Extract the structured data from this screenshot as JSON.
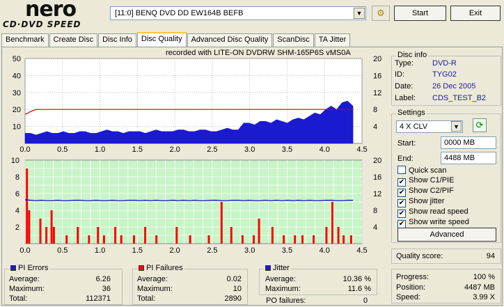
{
  "logo": {
    "brand": "nero",
    "product": "CD·DVD SPEED"
  },
  "drive": {
    "selected": "[11:0]  BENQ DVD DD EW164B BEFB"
  },
  "toolbar": {
    "start_label": "Start",
    "exit_label": "Exit"
  },
  "tabs": [
    {
      "label": "Benchmark"
    },
    {
      "label": "Create Disc"
    },
    {
      "label": "Disc Info"
    },
    {
      "label": "Disc Quality",
      "active": true
    },
    {
      "label": "Advanced Disc Quality"
    },
    {
      "label": "ScanDisc"
    },
    {
      "label": "TA Jitter"
    }
  ],
  "recorded_with": "recorded with LITE-ON DVDRW SHM-165P6S vMS0A",
  "disc_info": {
    "title": "Disc info",
    "type_label": "Type:",
    "type": "DVD-R",
    "id_label": "ID:",
    "id": "TYG02",
    "date_label": "Date:",
    "date": "26 Dec 2005",
    "label_label": "Label:",
    "label": "CDS_TEST_B2"
  },
  "settings": {
    "title": "Settings",
    "speed": "4 X CLV",
    "start_label": "Start:",
    "start": "0000 MB",
    "end_label": "End:",
    "end": "4488 MB",
    "quick_scan": "Quick scan",
    "show_c1": "Show C1/PIE",
    "show_c2": "Show C2/PIF",
    "show_jitter": "Show jitter",
    "show_read": "Show read speed",
    "show_write": "Show write speed",
    "advanced": "Advanced"
  },
  "checkboxes": {
    "quick_scan": false,
    "c1": true,
    "c2": true,
    "jitter": true,
    "read": true,
    "write": true
  },
  "quality": {
    "label": "Quality score:",
    "value": "94"
  },
  "status": {
    "progress_label": "Progress:",
    "progress": "100 %",
    "position_label": "Position:",
    "position": "4487 MB",
    "speed_label": "Speed:",
    "speed": "3.99 X"
  },
  "pi_errors": {
    "title": "PI Errors",
    "avg_label": "Average:",
    "avg": "6.26",
    "max_label": "Maximum:",
    "max": "36",
    "total_label": "Total:",
    "total": "112371"
  },
  "pi_failures": {
    "title": "PI Failures",
    "avg_label": "Average:",
    "avg": "0.02",
    "max_label": "Maximum:",
    "max": "10",
    "total_label": "Total:",
    "total": "2890"
  },
  "jitter": {
    "title": "Jitter",
    "avg_label": "Average:",
    "avg": "10.36 %",
    "max_label": "Maximum:",
    "max": "11.6 %",
    "po_label": "PO failures:",
    "po": "0"
  },
  "colors": {
    "pie": "#1a1ad0",
    "pif": "#ff0000",
    "jitter": "#0000c0",
    "speed": "#d00000",
    "green_bg": "#c8f4c8"
  },
  "chart_data": [
    {
      "type": "area",
      "x_ticks": [
        "0.0",
        "0.5",
        "1.0",
        "1.5",
        "2.0",
        "2.5",
        "3.0",
        "3.5",
        "4.0",
        "4.5"
      ],
      "y_ticks_left": [
        "10",
        "20",
        "30",
        "40",
        "50"
      ],
      "y_ticks_right": [
        "4",
        "8",
        "12",
        "16",
        "20"
      ],
      "xlim": [
        0,
        4.5
      ],
      "ylim": [
        0,
        50
      ],
      "y2lim": [
        0,
        20
      ],
      "series": [
        {
          "values": [
            6,
            6,
            5,
            6,
            7,
            6,
            6,
            7,
            6,
            6,
            7,
            7,
            6,
            6,
            7,
            8,
            7,
            7,
            6,
            7,
            7,
            7,
            6,
            7,
            8,
            7,
            7,
            7,
            8,
            8,
            7,
            7,
            8,
            8,
            7,
            7,
            8,
            9,
            8,
            8,
            12,
            12,
            11,
            13,
            13,
            12,
            14,
            13,
            12,
            14,
            15,
            14,
            16,
            18,
            17,
            20,
            22,
            20,
            24,
            25,
            22
          ]
        },
        {
          "values": [
            6.8,
            7.5,
            8,
            8,
            8,
            8,
            8,
            8,
            8,
            8,
            8,
            8,
            8,
            8,
            8,
            8,
            8,
            8,
            8,
            8,
            8,
            8,
            8,
            8,
            8,
            8,
            8,
            8,
            8,
            8,
            8,
            8,
            8,
            8,
            8,
            8,
            8,
            8,
            8,
            8,
            8,
            8,
            8,
            8,
            8,
            8,
            8,
            8,
            8,
            8,
            8,
            8,
            8,
            8,
            8,
            8,
            8,
            8,
            8,
            8,
            8
          ]
        }
      ]
    },
    {
      "type": "bar",
      "x_ticks": [
        "0.0",
        "0.5",
        "1.0",
        "1.5",
        "2.0",
        "2.5",
        "3.0",
        "3.5",
        "4.0",
        "4.5"
      ],
      "y_ticks_left": [
        "2",
        "4",
        "6",
        "8",
        "10"
      ],
      "y_ticks_right": [
        "4",
        "8",
        "12",
        "16",
        "20"
      ],
      "xlim": [
        0,
        4.5
      ],
      "ylim": [
        0,
        10
      ],
      "y2lim": [
        0,
        20
      ],
      "series": [
        {
          "points": [
            [
              0.02,
              9
            ],
            [
              0.05,
              4
            ],
            [
              0.2,
              3
            ],
            [
              0.28,
              2
            ],
            [
              0.35,
              4
            ],
            [
              0.38,
              2
            ],
            [
              0.55,
              1
            ],
            [
              0.7,
              2
            ],
            [
              0.85,
              1
            ],
            [
              0.97,
              2
            ],
            [
              1.05,
              1
            ],
            [
              1.2,
              2
            ],
            [
              1.28,
              1
            ],
            [
              1.45,
              1
            ],
            [
              1.6,
              2
            ],
            [
              1.75,
              1
            ],
            [
              2.02,
              2
            ],
            [
              2.2,
              1
            ],
            [
              2.45,
              1
            ],
            [
              2.62,
              5
            ],
            [
              2.75,
              2
            ],
            [
              2.9,
              1
            ],
            [
              3.05,
              1
            ],
            [
              3.12,
              3
            ],
            [
              3.3,
              2
            ],
            [
              3.45,
              1
            ],
            [
              3.6,
              1
            ],
            [
              3.7,
              1
            ],
            [
              3.85,
              1
            ],
            [
              4.02,
              2
            ],
            [
              4.1,
              5
            ],
            [
              4.18,
              2
            ],
            [
              4.25,
              1
            ],
            [
              4.35,
              1
            ]
          ]
        },
        {
          "values": [
            10.5,
            10.4,
            10.3,
            10.4,
            10.3,
            10.3,
            10.4,
            10.3,
            10.3,
            10.4,
            10.4,
            10.3,
            10.3,
            10.4,
            10.3,
            10.3,
            10.4,
            10.3,
            10.3,
            10.4,
            10.4,
            10.3,
            10.4,
            10.3,
            10.4,
            10.3,
            10.3,
            10.4,
            10.3,
            10.4,
            10.3,
            10.4,
            10.3,
            10.3,
            10.4,
            10.4,
            10.3,
            10.3,
            10.4,
            10.4,
            10.3,
            10.4,
            10.3,
            10.3,
            10.4,
            10.3,
            10.4,
            10.3,
            10.4,
            10.3,
            10.4,
            10.3,
            10.4,
            10.3,
            10.3,
            10.4,
            10.4,
            10.3,
            10.3,
            10.4,
            10.4
          ]
        }
      ]
    }
  ]
}
